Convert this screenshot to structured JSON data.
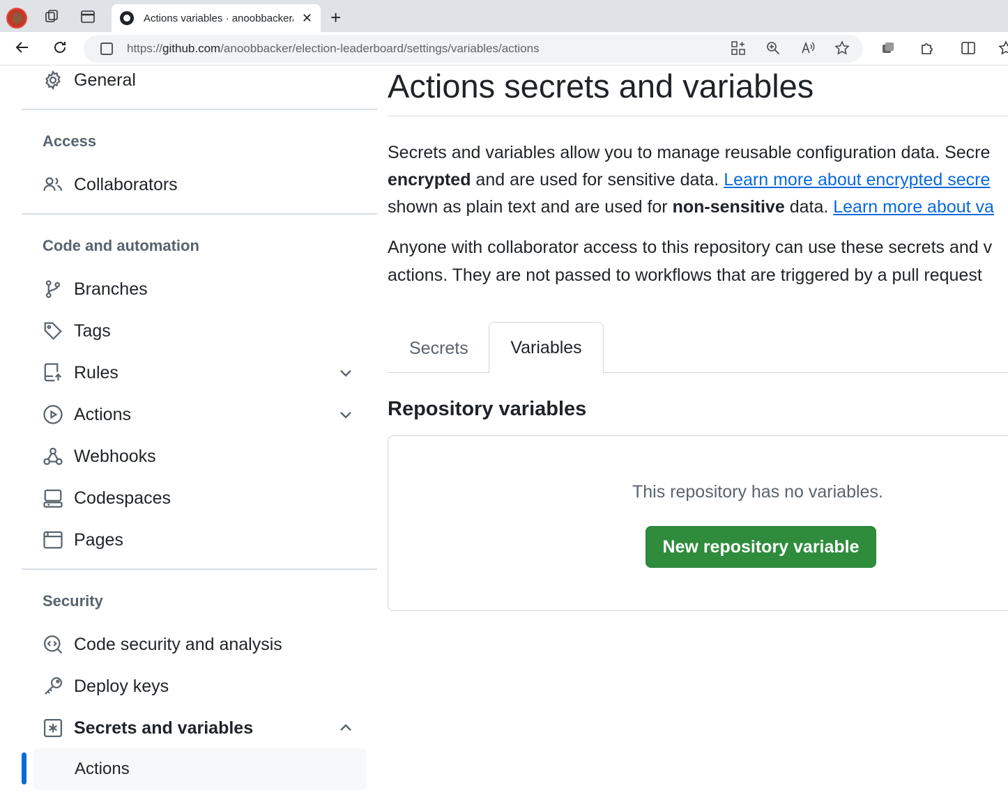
{
  "browser": {
    "tab_title": "Actions variables · anoobbacker/election-leaderboard",
    "tab_close": "✕",
    "new_tab": "+",
    "url_prefix": "https://",
    "url_host": "github.com",
    "url_path": "/anoobbacker/election-leaderboard/settings/variables/actions"
  },
  "sidebar": {
    "general": "General",
    "access_heading": "Access",
    "collaborators": "Collaborators",
    "code_heading": "Code and automation",
    "branches": "Branches",
    "tags": "Tags",
    "rules": "Rules",
    "actions": "Actions",
    "webhooks": "Webhooks",
    "codespaces": "Codespaces",
    "pages": "Pages",
    "security_heading": "Security",
    "code_security": "Code security and analysis",
    "deploy_keys": "Deploy keys",
    "secrets_and_variables": "Secrets and variables",
    "actions_sub": "Actions"
  },
  "main": {
    "title": "Actions secrets and variables",
    "desc_line1": "Secrets and variables allow you to manage reusable configuration data. Secre",
    "desc_line2_bold": "encrypted",
    "desc_line2_text": " and are used for sensitive data. ",
    "desc_line2_link": "Learn more about encrypted secre",
    "desc_line3_text": "shown as plain text and are used for ",
    "desc_line3_bold": "non-sensitive",
    "desc_line3_text2": " data. ",
    "desc_line3_link": "Learn more about va",
    "desc_line4": "Anyone with collaborator access to this repository can use these secrets and v",
    "desc_line5": "actions. They are not passed to workflows that are triggered by a pull request",
    "tab_secrets": "Secrets",
    "tab_variables": "Variables",
    "section_title": "Repository variables",
    "empty_text": "This repository has no variables.",
    "new_button": "New repository variable"
  },
  "colors": {
    "accent": "#0969da",
    "primary_button": "#2e8c3c"
  }
}
